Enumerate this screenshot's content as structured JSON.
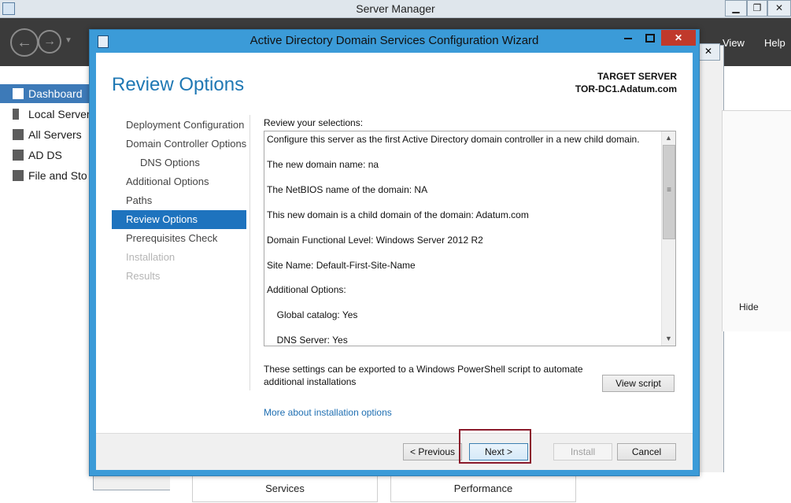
{
  "server_manager": {
    "title": "Server Manager",
    "window_controls": {
      "minimize": "▁",
      "maximize": "❐",
      "close": "✕"
    },
    "menu": {
      "view": "View",
      "help": "Help"
    },
    "sidebar": [
      {
        "label": "Dashboard",
        "icon": "dashboard-icon",
        "active": true
      },
      {
        "label": "Local Server",
        "icon": "local-server-icon"
      },
      {
        "label": "All Servers",
        "icon": "all-servers-icon"
      },
      {
        "label": "AD DS",
        "icon": "ad-ds-icon"
      },
      {
        "label": "File and Sto",
        "icon": "file-storage-icon"
      }
    ],
    "hide_label": "Hide",
    "tiles": [
      "Services",
      "Performance"
    ]
  },
  "wizard": {
    "title": "Active Directory Domain Services Configuration Wizard",
    "page_title": "Review Options",
    "target_server_label": "TARGET SERVER",
    "target_server_value": "TOR-DC1.Adatum.com",
    "steps": [
      {
        "label": "Deployment Configuration",
        "state": "normal"
      },
      {
        "label": "Domain Controller Options",
        "state": "normal"
      },
      {
        "label": "DNS Options",
        "state": "sub"
      },
      {
        "label": "Additional Options",
        "state": "normal"
      },
      {
        "label": "Paths",
        "state": "normal"
      },
      {
        "label": "Review Options",
        "state": "active"
      },
      {
        "label": "Prerequisites Check",
        "state": "normal"
      },
      {
        "label": "Installation",
        "state": "disabled"
      },
      {
        "label": "Results",
        "state": "disabled"
      }
    ],
    "review_label": "Review your selections:",
    "review_lines": [
      "Configure this server as the first Active Directory domain controller in a new child domain.",
      "The new domain name: na",
      "The NetBIOS name of the domain: NA",
      "This new domain is a child domain of the domain: Adatum.com",
      "Domain Functional Level: Windows Server 2012 R2",
      "Site Name: Default-First-Site-Name",
      "Additional Options:",
      "  Global catalog: Yes",
      "  DNS Server: Yes"
    ],
    "export_text": "These settings can be exported to a Windows PowerShell script to automate additional installations",
    "view_script_label": "View script",
    "more_link": "More about installation options",
    "buttons": {
      "previous": "< Previous",
      "next": "Next >",
      "install": "Install",
      "cancel": "Cancel"
    },
    "accent_color": "#3b9bd8",
    "highlight_color": "#8b1a2b"
  }
}
